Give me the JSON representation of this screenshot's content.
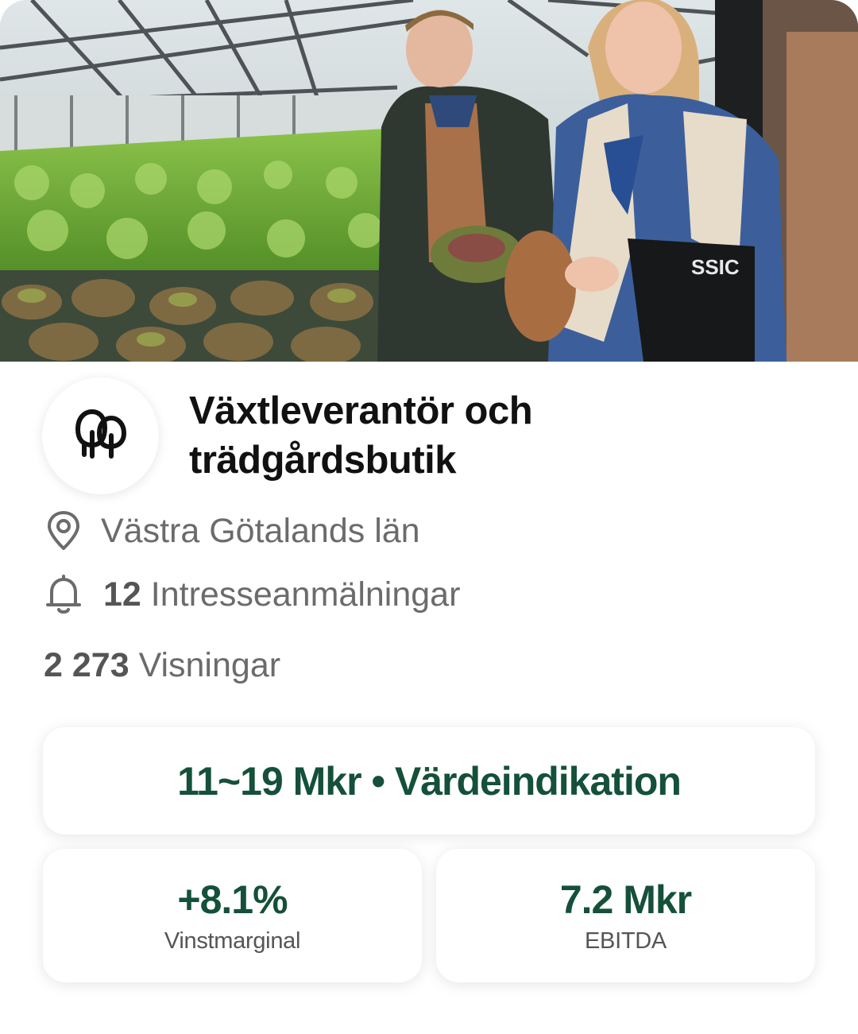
{
  "listing": {
    "title": "Växtleverantör och trädgårdsbutik",
    "logo_icon": "trees-icon",
    "location_icon": "location-pin-icon",
    "location": "Västra Götalands län",
    "interest_icon": "bell-icon",
    "interest_count": "12",
    "interest_label": "Intresseanmälningar",
    "views_count": "2 273",
    "views_label": "Visningar"
  },
  "valuation": {
    "text": "11~19 Mkr • Värdeindikation"
  },
  "stats": [
    {
      "value": "+8.1%",
      "label": "Vinstmarginal"
    },
    {
      "value": "7.2 Mkr",
      "label": "EBITDA"
    }
  ],
  "colors": {
    "accent": "#14503a",
    "muted_text": "#6b6b6b"
  }
}
